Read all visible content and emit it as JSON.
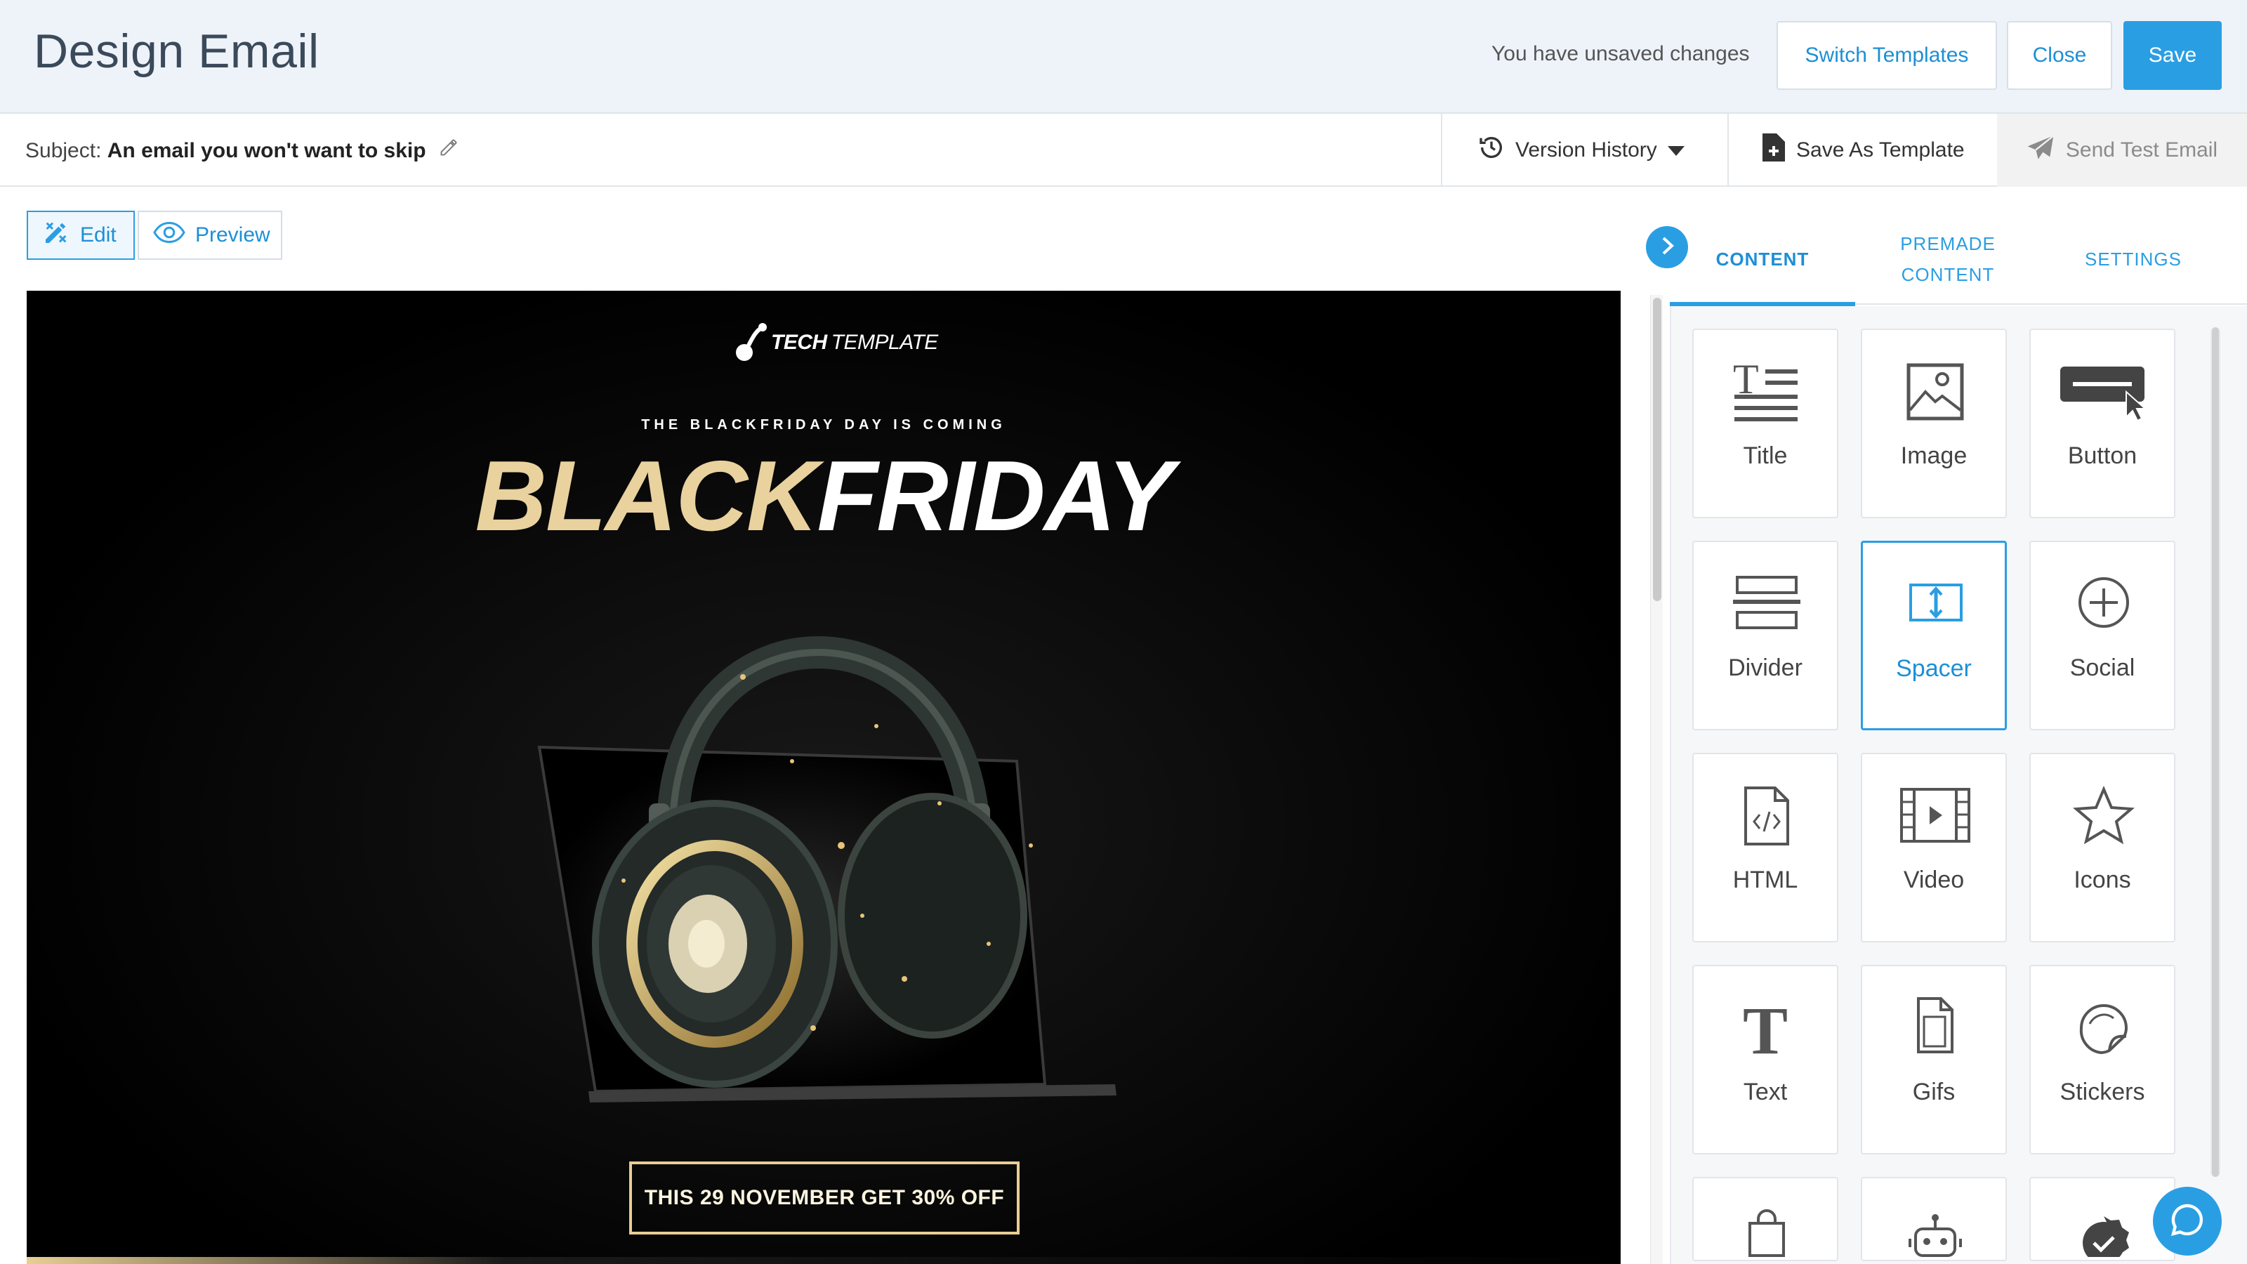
{
  "header": {
    "title": "Design Email",
    "unsaved": "You have unsaved changes",
    "switch_templates": "Switch Templates",
    "close": "Close",
    "save": "Save"
  },
  "subject_bar": {
    "subject_label": "Subject:",
    "subject_value": "An email you won't want to skip",
    "version_history": "Version History",
    "save_as_template": "Save As Template",
    "send_test_email": "Send Test Email"
  },
  "mode": {
    "edit": "Edit",
    "preview": "Preview"
  },
  "email": {
    "logo_bold": "TECH",
    "logo_light": "TEMPLATE",
    "tagline": "THE BLACKFRIDAY DAY IS COMING",
    "title_part1": "BLACK",
    "title_part2": "FRIDAY",
    "cta": "THIS 29 NOVEMBER GET 30% OFF"
  },
  "panel": {
    "tabs": {
      "content": "CONTENT",
      "premade_line1": "PREMADE",
      "premade_line2": "CONTENT",
      "settings": "SETTINGS"
    },
    "blocks": [
      {
        "label": "Title",
        "icon": "title-icon"
      },
      {
        "label": "Image",
        "icon": "image-icon"
      },
      {
        "label": "Button",
        "icon": "button-icon"
      },
      {
        "label": "Divider",
        "icon": "divider-icon"
      },
      {
        "label": "Spacer",
        "icon": "spacer-icon",
        "selected": true
      },
      {
        "label": "Social",
        "icon": "social-icon"
      },
      {
        "label": "HTML",
        "icon": "html-icon"
      },
      {
        "label": "Video",
        "icon": "video-icon"
      },
      {
        "label": "Icons",
        "icon": "star-icon"
      },
      {
        "label": "Text",
        "icon": "text-icon"
      },
      {
        "label": "Gifs",
        "icon": "gif-icon"
      },
      {
        "label": "Stickers",
        "icon": "sticker-icon"
      },
      {
        "label": "",
        "icon": "shopping-bag-icon"
      },
      {
        "label": "",
        "icon": "robot-icon"
      },
      {
        "label": "",
        "icon": "verified-badge-icon"
      }
    ]
  },
  "colors": {
    "accent": "#2a9ee3",
    "gold": "#e9d29e",
    "header_bg": "#eef3fa"
  }
}
